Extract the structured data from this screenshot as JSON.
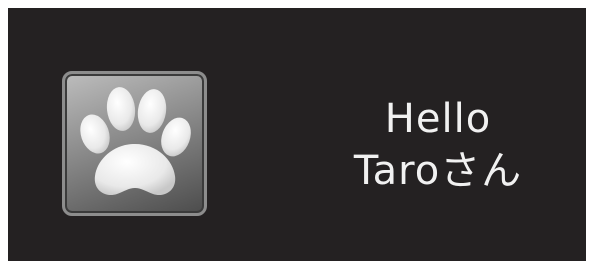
{
  "profile": {
    "icon": "paw-icon",
    "colors": {
      "background": "#242122",
      "tile_light": "#bdbdbd",
      "tile_dark": "#4c4c4c",
      "text": "#f1f1f1"
    }
  },
  "greeting": {
    "line1": "Hello",
    "line2": "Taroさん"
  }
}
